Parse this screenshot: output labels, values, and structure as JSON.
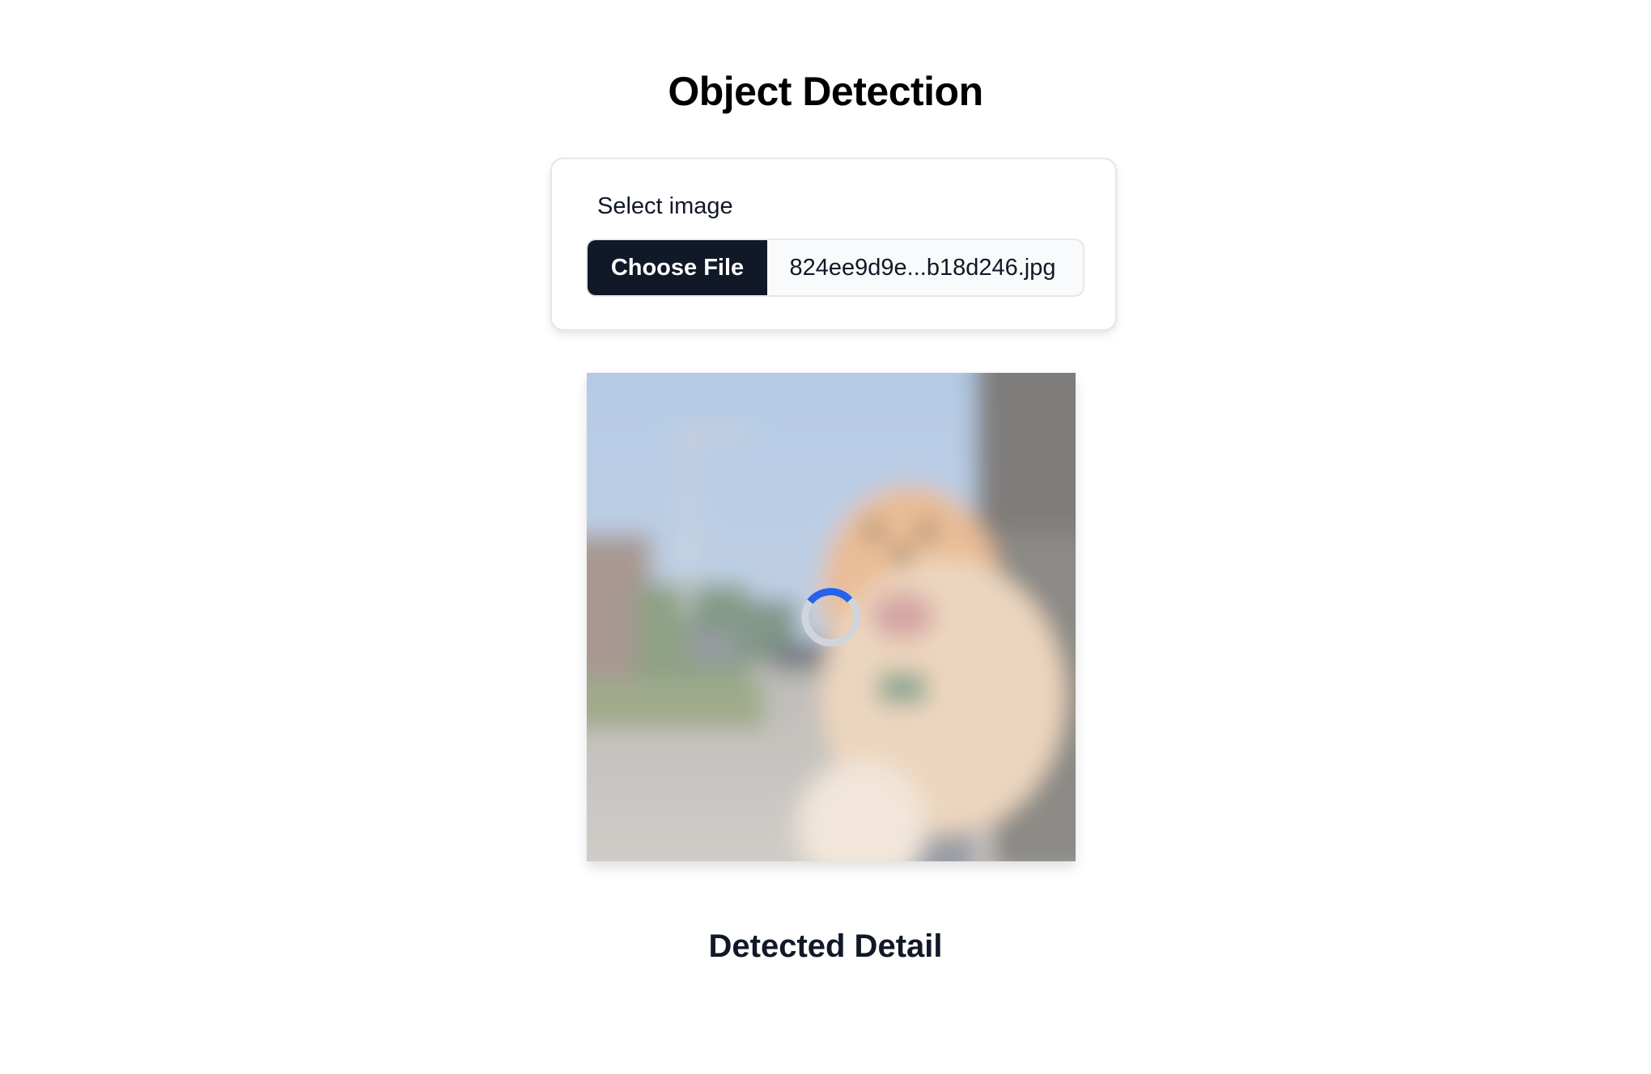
{
  "page": {
    "title": "Object Detection"
  },
  "upload": {
    "label": "Select image",
    "button_label": "Choose File",
    "file_name": "824ee9d9e...b18d246.jpg"
  },
  "preview": {
    "state": "loading",
    "spinner_icon": "spinner-icon",
    "colors": {
      "spinner_track": "#d1d5db",
      "spinner_active": "#2563eb"
    }
  },
  "results": {
    "title": "Detected Detail"
  },
  "colors": {
    "button_bg": "#111827",
    "card_border": "#e5e7eb"
  }
}
